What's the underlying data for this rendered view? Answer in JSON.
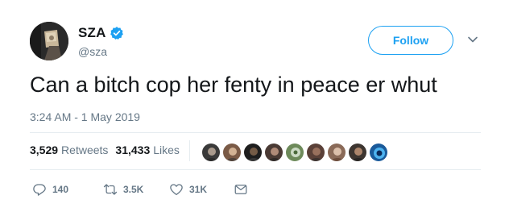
{
  "tweet": {
    "author": {
      "display_name": "SZA",
      "handle": "@sza",
      "verified": true,
      "avatar_icon": "avatar-photo"
    },
    "follow_label": "Follow",
    "menu_icon": "chevron-down-icon",
    "text": "Can a bitch cop her fenty in peace er whut",
    "timestamp": "3:24 AM - 1 May 2019",
    "stats": {
      "retweets_count": "3,529",
      "retweets_label": "Retweets",
      "likes_count": "31,433",
      "likes_label": "Likes"
    },
    "liked_by_avatars": [
      {
        "icon": "user-avatar-1",
        "color": "#3a3a3a"
      },
      {
        "icon": "user-avatar-2",
        "color": "#7a5a46"
      },
      {
        "icon": "user-avatar-3",
        "color": "#1e1e1e"
      },
      {
        "icon": "user-avatar-4",
        "color": "#4a3a34"
      },
      {
        "icon": "user-avatar-5",
        "color": "#6d8a5a"
      },
      {
        "icon": "user-avatar-6",
        "color": "#5a4038"
      },
      {
        "icon": "user-avatar-7",
        "color": "#8a6a58"
      },
      {
        "icon": "user-avatar-8",
        "color": "#3d3530"
      },
      {
        "icon": "user-avatar-9",
        "color": "#1a5a9a"
      }
    ],
    "actions": {
      "reply_count": "140",
      "retweet_count": "3.5K",
      "like_count": "31K"
    }
  },
  "colors": {
    "accent": "#1da1f2",
    "secondary_text": "#657786",
    "primary_text": "#14171a",
    "divider": "#e6ecf0"
  }
}
